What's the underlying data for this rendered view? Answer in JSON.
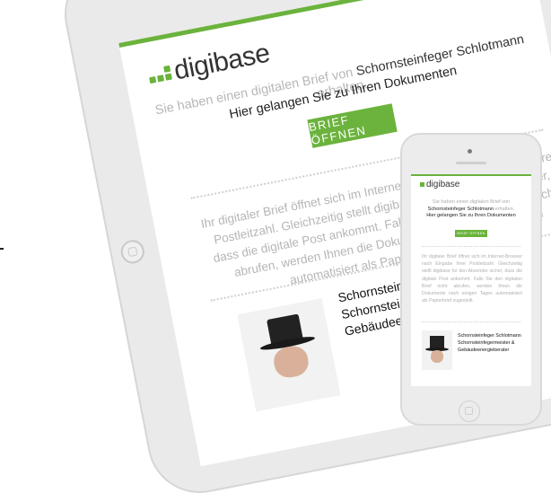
{
  "brand": {
    "logo_text": "digibase",
    "accent": "#6bb33d"
  },
  "email": {
    "lead_prefix": "Sie haben einen digitalen Brief von",
    "sender_name": "Schornsteinfeger Schlotmann",
    "lead_suffix": "erhalten.",
    "cta_line": "Hier gelangen Sie zu Ihren Dokumenten",
    "cta_button": "BRIEF ÖFFNEN",
    "body": "Ihr digitaler Brief öffnet sich im Internet-Browser nach Eingabe Ihrer Postleitzahl. Gleichzeitig stellt digibase für den Absender sicher, dass die digitale Post ankommt. Falls Sie den digitalen Brief nicht abrufen, werden Ihnen die Dokumente nach einigen Tagen automatisiert als Papierbrief zugestellt.",
    "sender_block": {
      "name": "Schornsteinfeger Schlotmann",
      "title_line_1": "Schornsteinfegermeister &",
      "title_line_2": "Gebäudeenergieberater"
    }
  },
  "phone_email": {
    "logo_text": "digibase",
    "lead_prefix": "Sie haben einen digitalen Brief von",
    "sender_name": "Schornsteinfeger Schlotmann",
    "lead_suffix": "erhalten.",
    "cta_line": "Hier gelangen Sie zu Ihren Dokumenten",
    "cta_button": "BRIEF ÖFFNEN",
    "body": "Ihr digitaler Brief öffnet sich im Internet-Browser nach Eingabe Ihrer Postleitzahl. Gleichzeitig stellt digibase für den Absender sicher, dass die digitale Post ankommt. Falls Sie den digitalen Brief nicht abrufen, werden Ihnen die Dokumente nach einigen Tagen automatisiert als Papierbrief zugestellt.",
    "sender_name_line": "Schornsteinfeger Schlotmann",
    "sender_title_1": "Schornsteinfegermeister &",
    "sender_title_2": "Gebäudeenergieberater"
  }
}
